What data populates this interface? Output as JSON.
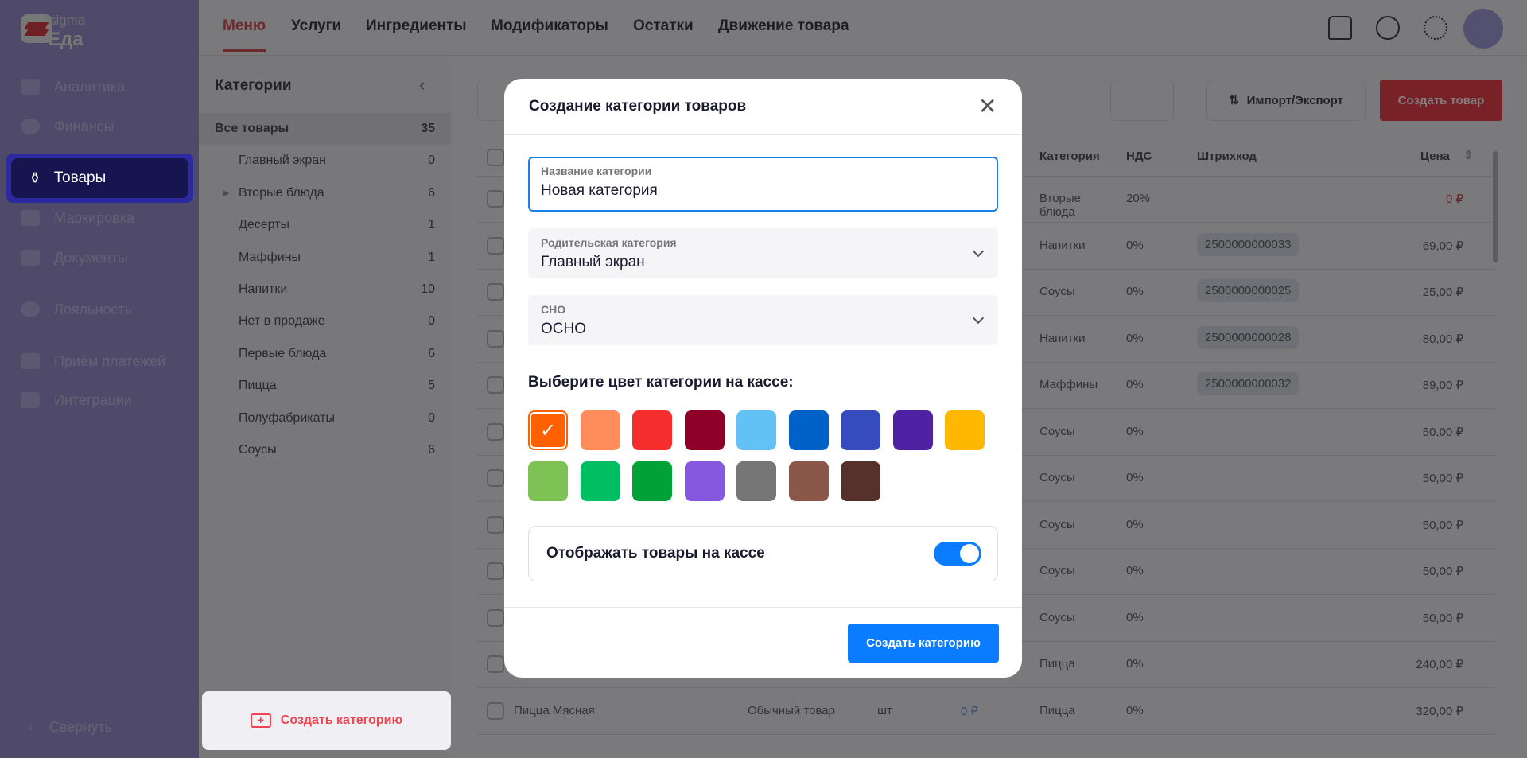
{
  "logo": {
    "line1": "sigma",
    "line2": "Еда"
  },
  "sidebar": {
    "items": [
      {
        "label": "Аналитика",
        "icon": "chart-icon"
      },
      {
        "label": "Финансы",
        "icon": "ruble-icon"
      },
      {
        "label": "Товары",
        "icon": "products-icon"
      },
      {
        "label": "Маркировка",
        "icon": "qr-icon"
      },
      {
        "label": "Документы",
        "icon": "folder-icon"
      },
      {
        "label": "Лояльность",
        "icon": "discount-icon"
      },
      {
        "label": "Приём платежей",
        "icon": "card-icon"
      },
      {
        "label": "Интеграции",
        "icon": "puzzle-icon"
      }
    ],
    "collapse": "Свернуть"
  },
  "header": {
    "tabs": [
      "Меню",
      "Услуги",
      "Ингредиенты",
      "Модификаторы",
      "Остатки",
      "Движение товара"
    ]
  },
  "categories": {
    "title": "Категории",
    "items": [
      {
        "label": "Все товары",
        "count": "35"
      },
      {
        "label": "Главный экран",
        "count": "0"
      },
      {
        "label": "Вторые блюда",
        "count": "6"
      },
      {
        "label": "Десерты",
        "count": "1"
      },
      {
        "label": "Маффины",
        "count": "1"
      },
      {
        "label": "Напитки",
        "count": "10"
      },
      {
        "label": "Нет в продаже",
        "count": "0"
      },
      {
        "label": "Первые блюда",
        "count": "6"
      },
      {
        "label": "Пицца",
        "count": "5"
      },
      {
        "label": "Полуфабрикаты",
        "count": "0"
      },
      {
        "label": "Соусы",
        "count": "6"
      }
    ],
    "create": "Создать категорию"
  },
  "toolbar": {
    "import_export": "Импорт/Экспорт",
    "create_product": "Создать товар"
  },
  "table": {
    "headers": {
      "category": "Категория",
      "vat": "НДС",
      "barcode": "Штрихкод",
      "price": "Цена"
    },
    "rows": [
      {
        "category": "Вторые блюда",
        "vat": "20%",
        "barcode": "",
        "price": "0 ₽"
      },
      {
        "category": "Напитки",
        "vat": "0%",
        "barcode": "2500000000033",
        "price": "69,00 ₽"
      },
      {
        "category": "Соусы",
        "vat": "0%",
        "barcode": "2500000000025",
        "price": "25,00 ₽"
      },
      {
        "category": "Напитки",
        "vat": "0%",
        "barcode": "2500000000028",
        "price": "80,00 ₽"
      },
      {
        "category": "Маффины",
        "vat": "0%",
        "barcode": "2500000000032",
        "price": "89,00 ₽"
      },
      {
        "category": "Соусы",
        "vat": "0%",
        "barcode": "",
        "price": "50,00 ₽"
      },
      {
        "category": "Соусы",
        "vat": "0%",
        "barcode": "",
        "price": "50,00 ₽"
      },
      {
        "category": "Соусы",
        "vat": "0%",
        "barcode": "",
        "price": "50,00 ₽"
      },
      {
        "category": "Соусы",
        "vat": "0%",
        "barcode": "",
        "price": "50,00 ₽"
      },
      {
        "category": "Соусы",
        "vat": "0%",
        "barcode": "",
        "price": "50,00 ₽"
      },
      {
        "category": "Пицца",
        "vat": "0%",
        "barcode": "",
        "price": "240,00 ₽"
      },
      {
        "name": "Пицца Мясная",
        "type": "Обычный товар",
        "unit": "шт",
        "cost": "0 ₽",
        "category": "Пицца",
        "vat": "0%",
        "barcode": "",
        "price": "320,00 ₽"
      }
    ]
  },
  "modal": {
    "title": "Создание категории товаров",
    "name_label": "Название категории",
    "name_value": "Новая категория",
    "parent_label": "Родительская категория",
    "parent_value": "Главный экран",
    "sno_label": "СНО",
    "sno_value": "ОСНО",
    "color_label": "Выберите цвет категории на кассе:",
    "colors": [
      "#ff6000",
      "#ff8c5a",
      "#f52d2d",
      "#8e0028",
      "#62c1f5",
      "#0062c9",
      "#364bbd",
      "#4e22a3",
      "#ffb800",
      "#7dc255",
      "#00bf63",
      "#00a136",
      "#8658e0",
      "#767676",
      "#8a5748",
      "#56302a"
    ],
    "selected_color": 0,
    "show_label": "Отображать товары на кассе",
    "show_on": true,
    "submit": "Создать категорию"
  }
}
